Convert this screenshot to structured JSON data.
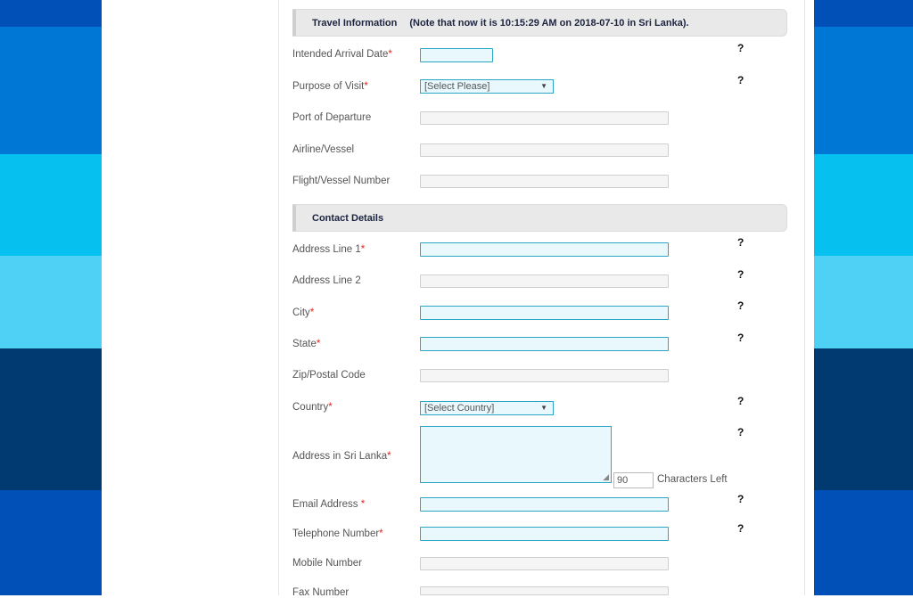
{
  "colors": {
    "stripes": [
      "#0050b8",
      "#0077d4",
      "#06c1ef",
      "#4fd1f6",
      "#003a70",
      "#0050b8"
    ],
    "required_border": "#2aa6c4",
    "required_bg": "#e9f8fd",
    "required_marker": "#e2231a"
  },
  "travel": {
    "title": "Travel Information",
    "note": "(Note that now it is 10:15:29 AM on 2018-07-10 in Sri Lanka).",
    "fields": [
      {
        "label": "Intended Arrival Date",
        "required": "*"
      },
      {
        "label": "Purpose of Visit",
        "required": "*",
        "value": "[Select Please]"
      },
      {
        "label": "Port of Departure"
      },
      {
        "label": "Airline/Vessel"
      },
      {
        "label": "Flight/Vessel Number"
      }
    ]
  },
  "contact": {
    "title": "Contact Details",
    "fields": [
      {
        "label": "Address Line 1",
        "required": "*"
      },
      {
        "label": "Address Line 2"
      },
      {
        "label": "City",
        "required": "*"
      },
      {
        "label": "State",
        "required": "*"
      },
      {
        "label": "Zip/Postal Code"
      },
      {
        "label": "Country",
        "required": "*",
        "value": "[Select Country]"
      },
      {
        "label": "Address in Sri Lanka",
        "required": "*"
      },
      {
        "label": "Email Address ",
        "required": "*"
      },
      {
        "label": "Telephone Number",
        "required": "*"
      },
      {
        "label": "Mobile Number"
      },
      {
        "label": "Fax Number"
      }
    ],
    "chars_left_value": "90",
    "chars_left_label": "Characters Left"
  },
  "help_symbol": "?",
  "select_arrow": "▼",
  "resize_glyph": "◢"
}
